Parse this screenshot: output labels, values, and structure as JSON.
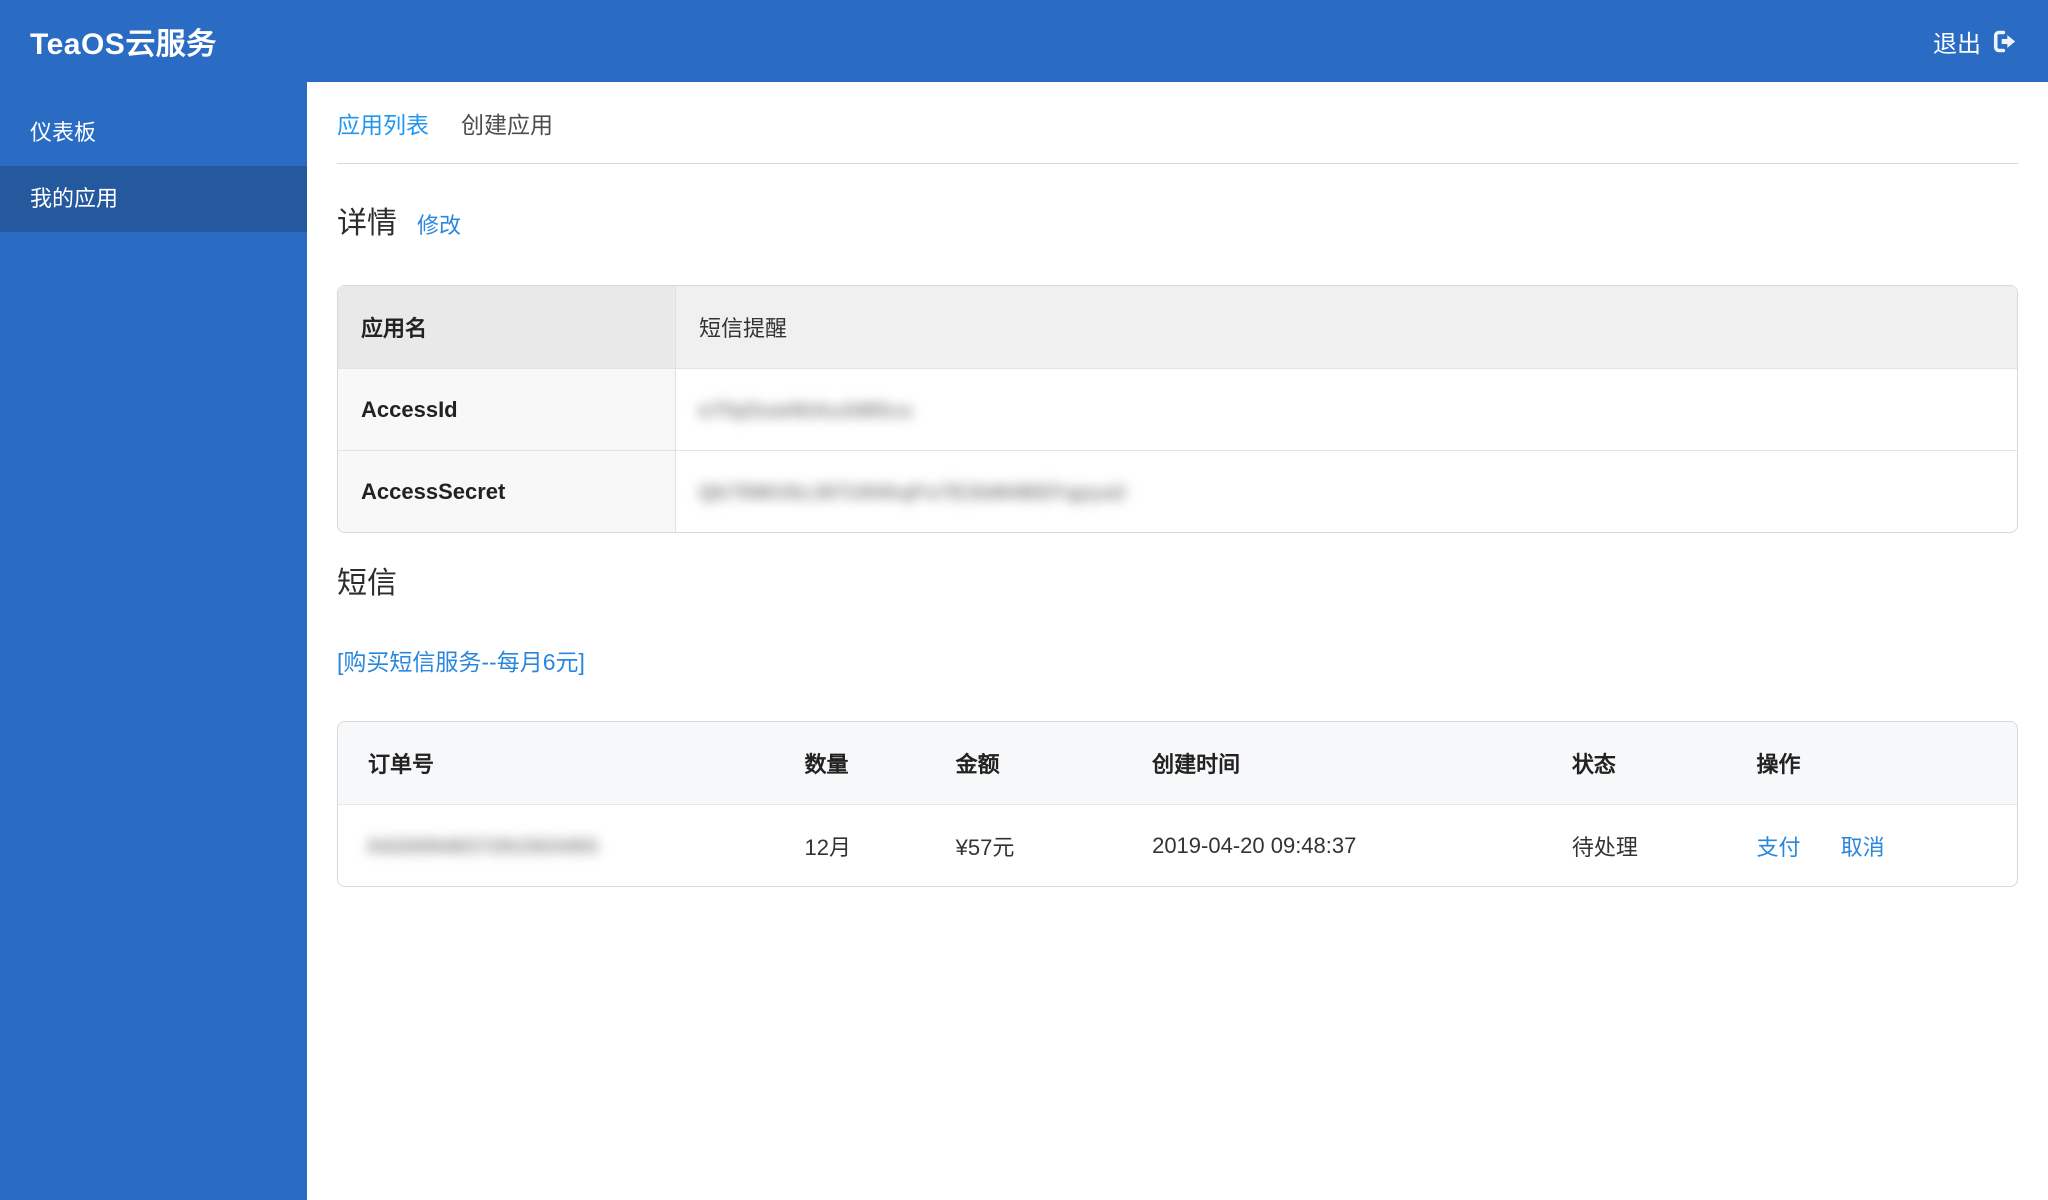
{
  "topbar": {
    "brand": "TeaOS云服务",
    "logout_label": "退出"
  },
  "sidebar": {
    "items": [
      {
        "label": "仪表板",
        "active": false
      },
      {
        "label": "我的应用",
        "active": true
      }
    ]
  },
  "tabs": [
    {
      "label": "应用列表",
      "active": true
    },
    {
      "label": "创建应用",
      "active": false
    }
  ],
  "details": {
    "heading": "详情",
    "edit_link": "修改",
    "rows": [
      {
        "label": "应用名",
        "value": "短信提醒",
        "masked": false
      },
      {
        "label": "AccessId",
        "value": "e7fqOuwNtAuAM5cu",
        "masked": true
      },
      {
        "label": "AccessSecret",
        "value": "Qk79WU9zJ87U94hqFo7E2bM4BEFqpya2",
        "masked": true
      }
    ]
  },
  "sms": {
    "heading": "短信",
    "buy_link": "[购买短信服务--每月6元]",
    "table": {
      "headers": [
        "订单号",
        "数量",
        "金额",
        "创建时间",
        "状态",
        "操作"
      ],
      "rows": [
        {
          "order_no": "0420094837291503493",
          "order_no_masked": true,
          "quantity": "12月",
          "amount": "¥57元",
          "created_at": "2019-04-20 09:48:37",
          "status": "待处理",
          "actions": [
            "支付",
            "取消"
          ]
        }
      ]
    }
  },
  "colors": {
    "primary_blue": "#2a6bc4",
    "sidebar_active_blue": "#24599e",
    "link_blue": "#2a87dd",
    "active_tab_blue": "#2196ef",
    "table_header_gray": "#e9e9e9",
    "orders_header_gray": "#f7f8f9"
  }
}
